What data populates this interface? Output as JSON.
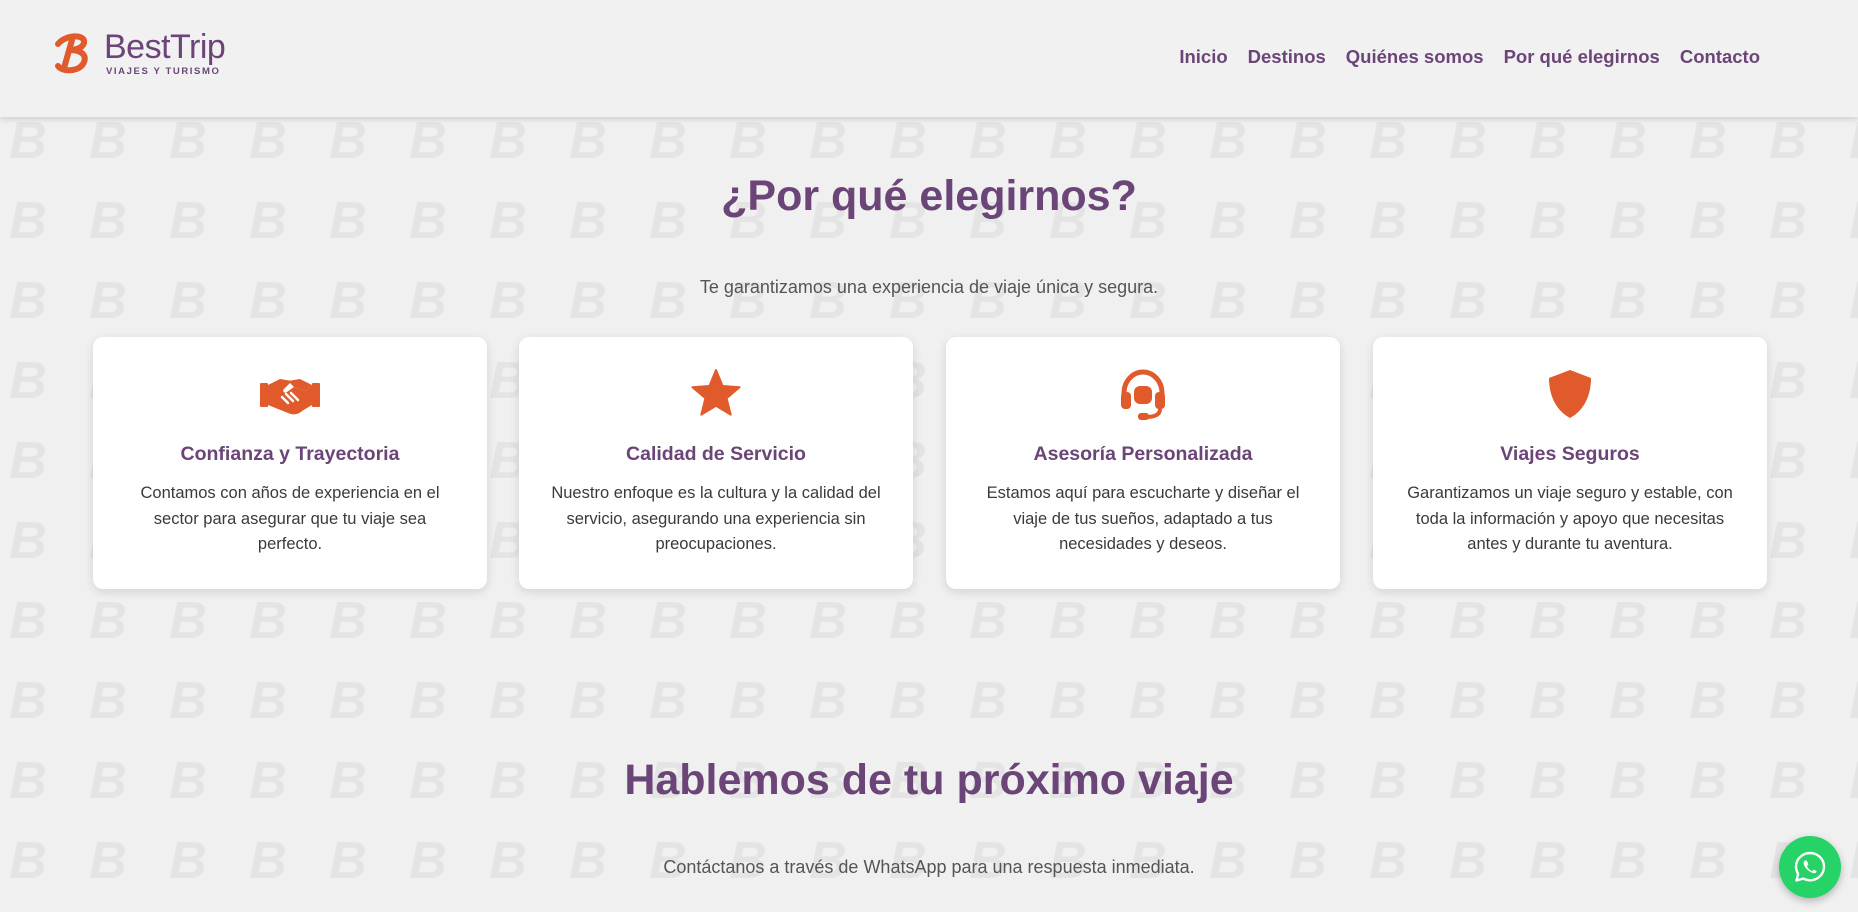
{
  "brand": {
    "name": "BestTrip",
    "tagline": "VIAJES Y TURISMO",
    "primary_color": "#6b4577",
    "accent_color": "#e05a2b"
  },
  "nav": {
    "items": [
      {
        "label": "Inicio"
      },
      {
        "label": "Destinos"
      },
      {
        "label": "Quiénes somos"
      },
      {
        "label": "Por qué elegirnos"
      },
      {
        "label": "Contacto"
      }
    ]
  },
  "why": {
    "title": "¿Por qué elegirnos?",
    "subtitle": "Te garantizamos una experiencia de viaje única y segura.",
    "cards": [
      {
        "icon": "handshake-icon",
        "title": "Confianza y Trayectoria",
        "text": "Contamos con años de experiencia en el sector para asegurar que tu viaje sea perfecto."
      },
      {
        "icon": "star-icon",
        "title": "Calidad de Servicio",
        "text": "Nuestro enfoque es la cultura y la calidad del servicio, asegurando una experiencia sin preocupaciones."
      },
      {
        "icon": "headset-icon",
        "title": "Asesoría Personalizada",
        "text": "Estamos aquí para escucharte y diseñar el viaje de tus sueños, adaptado a tus necesidades y deseos."
      },
      {
        "icon": "shield-icon",
        "title": "Viajes Seguros",
        "text": "Garantizamos un viaje seguro y estable, con toda la información y apoyo que necesitas antes y durante tu aventura."
      }
    ]
  },
  "contact": {
    "title": "Hablemos de tu próximo viaje",
    "subtitle": "Contáctanos a través de WhatsApp para una respuesta inmediata."
  },
  "whatsapp": {
    "icon": "whatsapp-icon",
    "color": "#25d366"
  }
}
